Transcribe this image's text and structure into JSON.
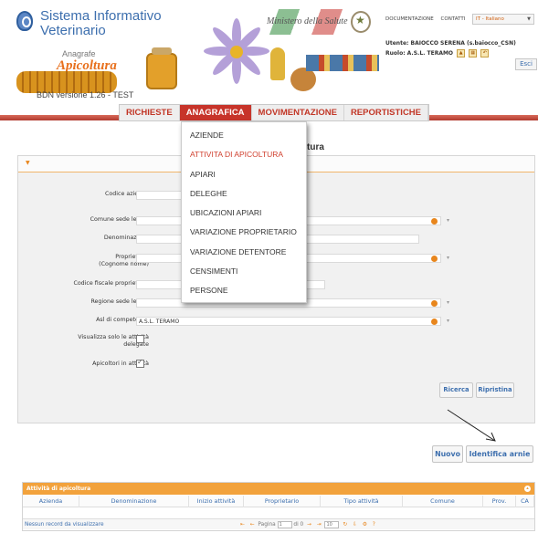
{
  "header": {
    "system_title_line1": "Sistema Informativo",
    "system_title_line2": "Veterinario",
    "anagrafe": "Anagrafe",
    "apicoltura": "Apicoltura",
    "version": "BDN versione 1.26 - TEST",
    "ministero": "Ministero della Salute",
    "top_links": [
      "DOCUMENTAZIONE",
      "CONTATTI"
    ],
    "language": "IT - Italiano",
    "user_label": "Utente: BAIOCCO SERENA (s.baiocco_CSN)",
    "role_label": "Ruolo: A.S.L. TERAMO",
    "logout": "Esci"
  },
  "nav": {
    "items": [
      "RICHIESTE",
      "ANAGRAFICA",
      "MOVIMENTAZIONE",
      "REPORTISTICHE"
    ],
    "active": "ANAGRAFICA"
  },
  "dropdown": {
    "items": [
      "AZIENDE",
      "ATTIVITA DI APICOLTURA",
      "APIARI",
      "DELEGHE",
      "UBICAZIONI APIARI",
      "VARIAZIONE PROPRIETARIO",
      "VARIAZIONE DETENTORE",
      "CENSIMENTI",
      "PERSONE"
    ],
    "highlighted": "ATTIVITA DI APICOLTURA"
  },
  "page": {
    "title_fragment": "tura"
  },
  "form": {
    "codice_azienda": "Codice azienda",
    "comune_sede_legale": "Comune sede legale",
    "denominazione": "Denominazione",
    "proprietario": "Proprietario",
    "proprietario_sub": "(Cognome nome)",
    "codice_fiscale": "Codice fiscale proprietario",
    "regione_sede_legale": "Regione sede legale",
    "asl_competenza": "Asl di competenza",
    "asl_value": "A.S.L. TERAMO",
    "visualizza_delegate_1": "Visualizza solo le attività",
    "visualizza_delegate_2": "delegate",
    "apicoltori_attivita": "Apicoltori in attività",
    "visualizza_checked": false,
    "apicoltori_checked": true,
    "ricerca": "Ricerca",
    "ripristina": "Ripristina"
  },
  "actions": {
    "nuovo": "Nuovo",
    "identifica_arnie": "Identifica arnie"
  },
  "grid": {
    "caption": "Attività di apicoltura",
    "columns": [
      "Azienda",
      "Denominazione",
      "Inizio attività",
      "Proprietario",
      "Tipo attività",
      "Comune",
      "Prov.",
      "CA"
    ],
    "empty_text": "Nessun record da visualizzare",
    "pager_page_label": "Pagina",
    "pager_page_value": "1",
    "pager_of": "di 0",
    "pager_rows": "10"
  },
  "colors": {
    "accent_orange": "#e8861d",
    "nav_red": "#c7342a",
    "link_blue": "#3d6fae",
    "grid_caption": "#f2a23c"
  }
}
